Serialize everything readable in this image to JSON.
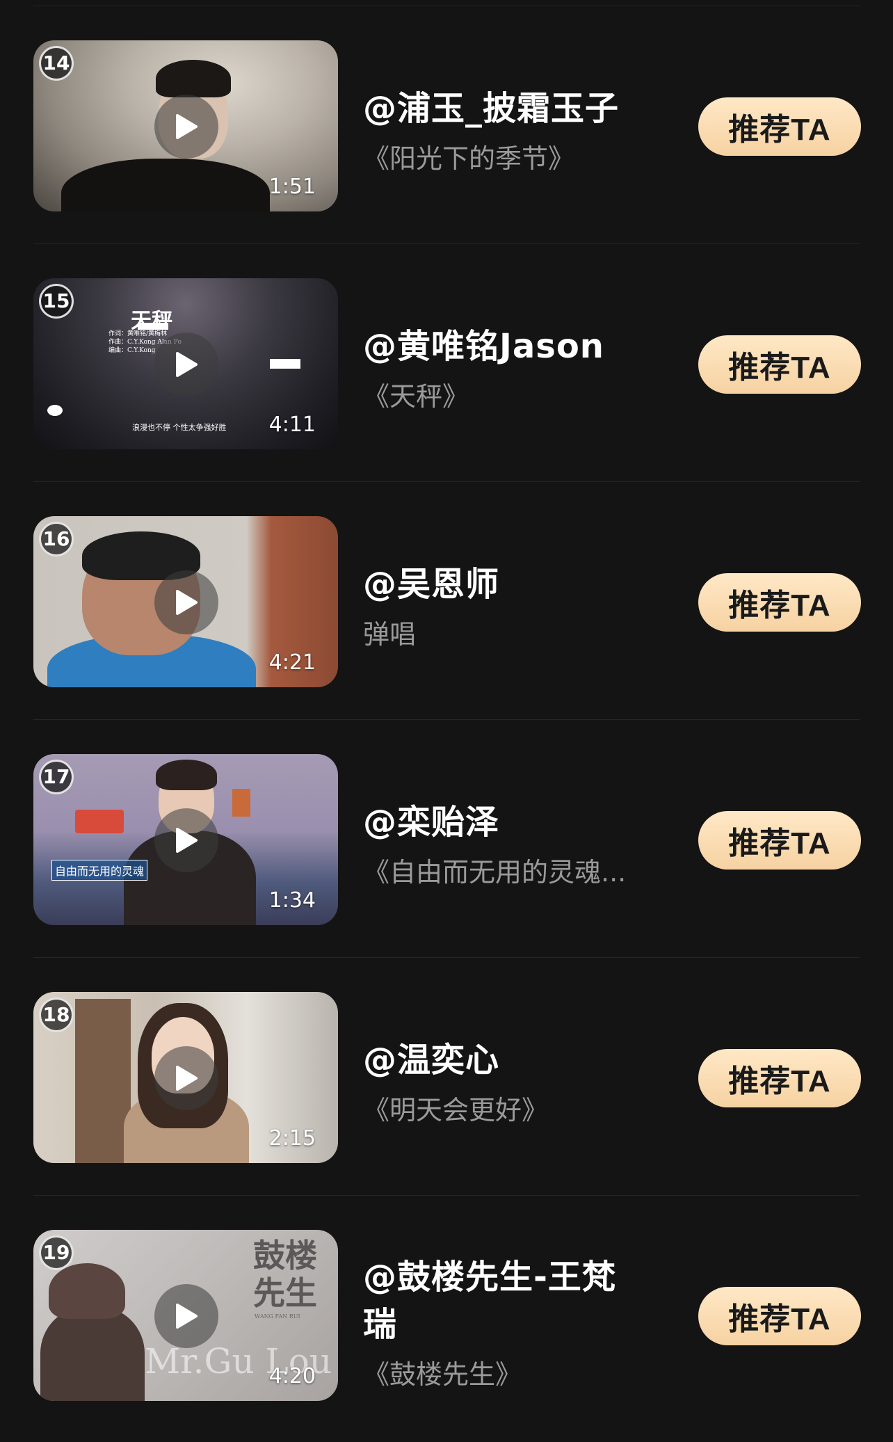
{
  "items": [
    {
      "rank": "14",
      "duration": "1:51",
      "name": "@浦玉_披霜玉子",
      "subtitle": "《阳光下的季节》",
      "button": "推荐TA"
    },
    {
      "rank": "15",
      "duration": "4:11",
      "name": "@黄唯铭Jason",
      "subtitle": "《天秤》",
      "button": "推荐TA",
      "overlay": {
        "title": "天秤",
        "credits_1": "作词：黄唯铭/黄梅林",
        "credits_2": "作曲：C.Y.Kong  Alan Po",
        "credits_3": "编曲：C.Y.Kong",
        "lyric": "浪漫也不停 个性太争强好胜"
      }
    },
    {
      "rank": "16",
      "duration": "4:21",
      "name": "@吴恩师",
      "subtitle": "弹唱",
      "button": "推荐TA"
    },
    {
      "rank": "17",
      "duration": "1:34",
      "name": "@栾贻泽",
      "subtitle": "《自由而无用的灵魂...",
      "button": "推荐TA",
      "overlay": {
        "banner": "自由而无用的灵魂"
      }
    },
    {
      "rank": "18",
      "duration": "2:15",
      "name": "@温奕心",
      "subtitle": "《明天会更好》",
      "button": "推荐TA"
    },
    {
      "rank": "19",
      "duration": "4:20",
      "name": "@鼓楼先生-王梵瑞",
      "subtitle": "《鼓楼先生》",
      "button": "推荐TA",
      "overlay": {
        "title_1": "鼓楼",
        "title_2": "先生",
        "small": "WANG FAN RUI",
        "english": "Mr.Gu Lou"
      }
    }
  ],
  "colors": {
    "background": "#141414",
    "button_top": "#ffe8c6",
    "button_bottom": "#f6d2a2",
    "subtitle": "#9a9a9a"
  },
  "icons": {
    "play": "play-icon"
  }
}
